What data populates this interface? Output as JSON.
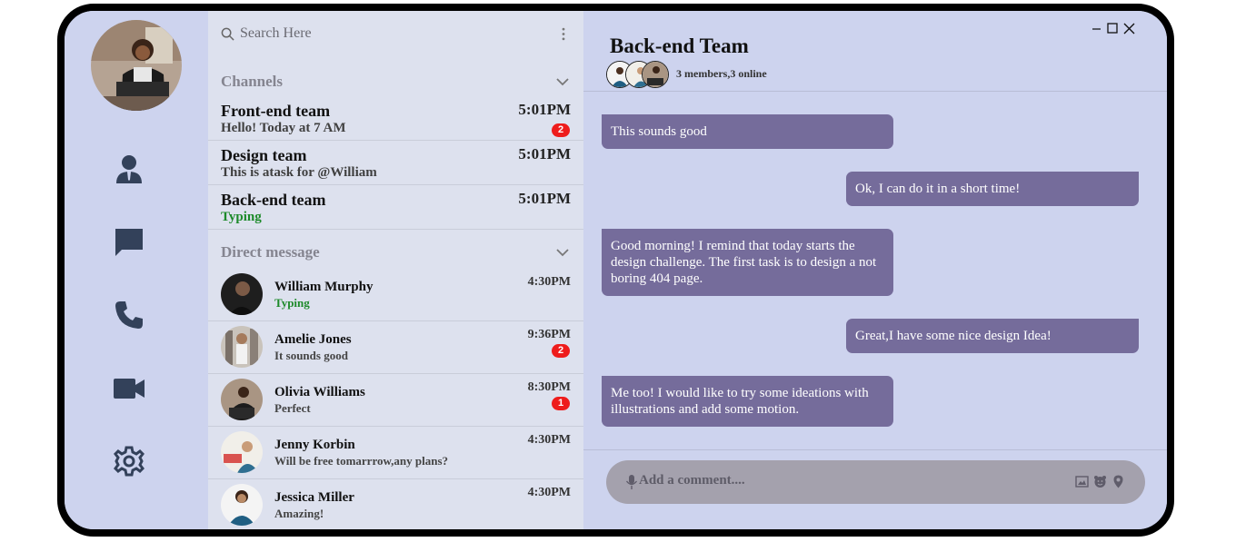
{
  "rail": {
    "icons": [
      "person-icon",
      "chat-bubble-icon",
      "phone-icon",
      "video-camera-icon",
      "settings-gear-icon"
    ]
  },
  "search": {
    "placeholder": "Search Here"
  },
  "channels": {
    "header": "Channels",
    "items": [
      {
        "name": "Front-end team",
        "message": "Hello! Today at 7 AM",
        "time": "5:01PM",
        "badge": "2"
      },
      {
        "name": "Design team",
        "message": "This is atask for @William",
        "time": "5:01PM"
      },
      {
        "name": "Back-end team",
        "message": "Typing",
        "time": "5:01PM",
        "typing": true
      }
    ]
  },
  "direct": {
    "header": "Direct message",
    "items": [
      {
        "name": "William Murphy",
        "message": "Typing",
        "time": "4:30PM",
        "typing": true
      },
      {
        "name": "Amelie Jones",
        "message": "It sounds good",
        "time": "9:36PM",
        "badge": "2"
      },
      {
        "name": "Olivia Williams",
        "message": "Perfect",
        "time": "8:30PM",
        "badge": "1"
      },
      {
        "name": "Jenny Korbin",
        "message": "Will be free tomarrrow,any plans?",
        "time": "4:30PM"
      },
      {
        "name": "Jessica Miller",
        "message": "Amazing!",
        "time": "4:30PM"
      }
    ]
  },
  "chat": {
    "title": "Back-end Team",
    "members_text": "3 members,3 online",
    "messages": [
      {
        "direction": "incoming",
        "text": "This sounds good"
      },
      {
        "direction": "outgoing",
        "text": "Ok, I can do it in a short time!"
      },
      {
        "direction": "incoming",
        "text": "Good morning! I remind that today starts the design challenge. The first task is to design a not boring 404 page."
      },
      {
        "direction": "outgoing",
        "text": "Great,I have some nice design Idea!"
      },
      {
        "direction": "incoming",
        "text": "Me too! I would like to try some ideations with illustrations and add some motion."
      }
    ],
    "composer_placeholder": "Add a comment....",
    "composer_tools": [
      "microphone-icon",
      "image-icon",
      "emoji-icon",
      "location-pin-icon"
    ]
  },
  "colors": {
    "frame": "#000000",
    "background": "#cdd3ee",
    "list_panel": "#dde1ee",
    "bubble": "#756c9b",
    "badge": "#ee1c1c",
    "typing": "#1d8a2a",
    "composer": "#a4a1ad"
  }
}
